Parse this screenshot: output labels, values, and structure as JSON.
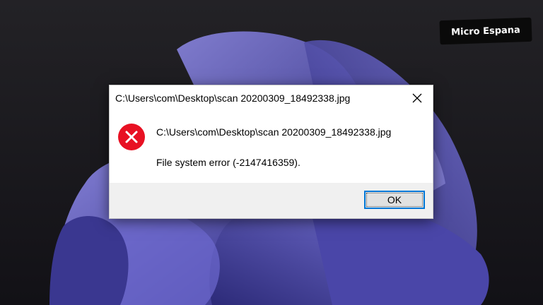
{
  "watermark": {
    "text": "Micro Espana"
  },
  "dialog": {
    "title": "C:\\Users\\com\\Desktop\\scan 20200309_18492338.jpg",
    "icon": "error-icon",
    "message_path": "C:\\Users\\com\\Desktop\\scan 20200309_18492338.jpg",
    "message_error": "File system error (-2147416359).",
    "ok_label": "OK"
  },
  "colors": {
    "error_red": "#e81123",
    "focus_blue": "#0078d7",
    "wallpaper_purple": "#5b57b8"
  }
}
